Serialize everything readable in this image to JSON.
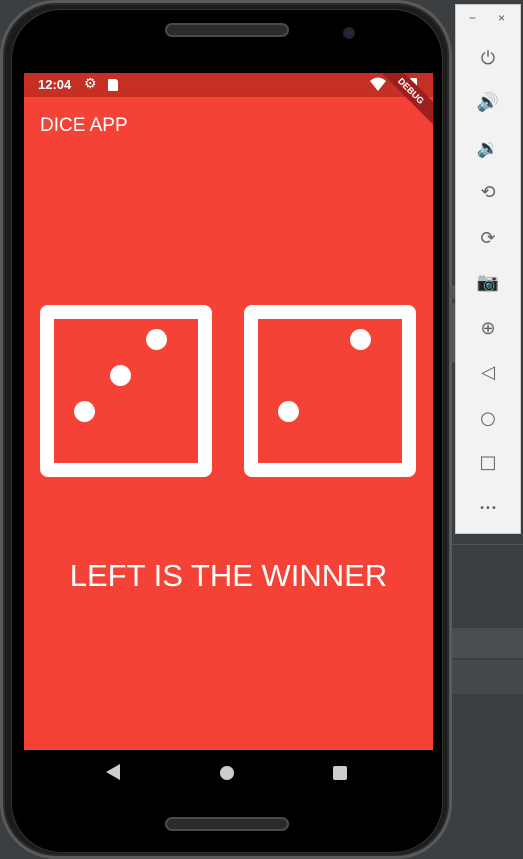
{
  "status_bar": {
    "time": "12:04",
    "settings_icon": "gear-icon",
    "sd_icon": "sd-card-icon",
    "wifi_icon": "wifi-icon",
    "battery_icon": "battery-icon"
  },
  "debug_banner": "DEBUG",
  "app_bar": {
    "title": "DICE APP"
  },
  "dice": {
    "left_value": 3,
    "right_value": 2
  },
  "result_text": "LEFT IS THE WINNER",
  "nav_bar": {
    "back_icon": "back-triangle-icon",
    "home_icon": "home-circle-icon",
    "recent_icon": "recent-square-icon"
  },
  "emulator_panel": {
    "minimize": "−",
    "close": "×",
    "buttons": [
      {
        "name": "power-icon",
        "glyph": "⏻"
      },
      {
        "name": "volume-up-icon",
        "glyph": "🔊"
      },
      {
        "name": "volume-down-icon",
        "glyph": "🔉"
      },
      {
        "name": "rotate-left-icon",
        "glyph": "⟲"
      },
      {
        "name": "rotate-right-icon",
        "glyph": "⟳"
      },
      {
        "name": "camera-icon",
        "glyph": "📷"
      },
      {
        "name": "zoom-icon",
        "glyph": "⊕"
      },
      {
        "name": "back-icon",
        "glyph": "◁"
      },
      {
        "name": "home-icon",
        "glyph": "○"
      },
      {
        "name": "overview-icon",
        "glyph": "□"
      },
      {
        "name": "more-icon",
        "glyph": "•••"
      }
    ]
  },
  "colors": {
    "app_bar": "#f44336",
    "status_bar": "#c62f24",
    "background": "#f44336"
  }
}
